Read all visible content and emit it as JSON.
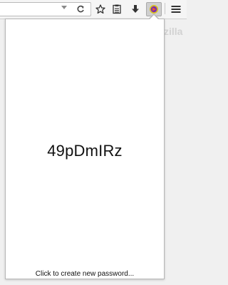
{
  "toolbar": {
    "urlbar_value": "",
    "icons": [
      "dropmarker-icon",
      "reload-icon",
      "bookmark-star-icon",
      "reading-list-icon",
      "download-icon",
      "password-extension-icon",
      "hamburger-menu-icon"
    ]
  },
  "page": {
    "background_text": "zilla"
  },
  "popup": {
    "password": "49pDmIRz",
    "create_link": "Click to create new password..."
  },
  "colors": {
    "extension_icon_ring": "#d8c020",
    "extension_icon_fill": "#7a2fb0",
    "extension_icon_center": "#e85a2a"
  }
}
